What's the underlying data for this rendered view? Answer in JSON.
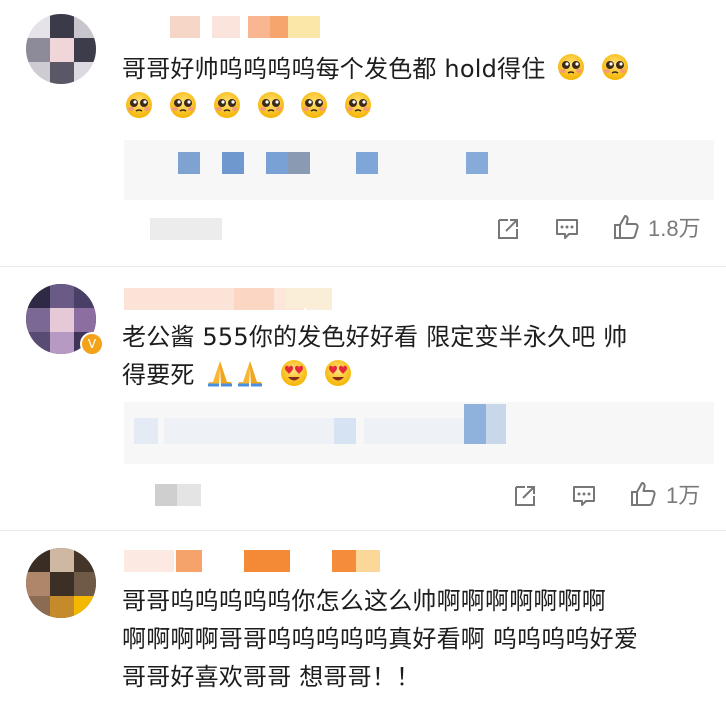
{
  "comments": [
    {
      "text_line1": "哥哥好帅呜呜呜呜每个发色都 hold得住",
      "text_line2": "",
      "like_count": "1.8万",
      "emoji": "pleading-face"
    },
    {
      "text_line1": "老公酱 555你的发色好好看 限定变半永久吧 帅",
      "text_line2": "得要死",
      "like_count": "1万",
      "emoji_praying": "praying-hands",
      "emoji_heart_eyes": "heart-eyes"
    },
    {
      "text_line1": "哥哥呜呜呜呜呜你怎么这么帅啊啊啊啊啊啊啊",
      "text_line2": "啊啊啊啊哥哥呜呜呜呜呜真好看啊 呜呜呜呜好爱",
      "text_line3": "哥哥好喜欢哥哥 想哥哥！！"
    }
  ],
  "colors": {
    "text": "#1d1d1d",
    "meta": "#7a7a7a",
    "reply_bg": "#f7f7f7"
  }
}
